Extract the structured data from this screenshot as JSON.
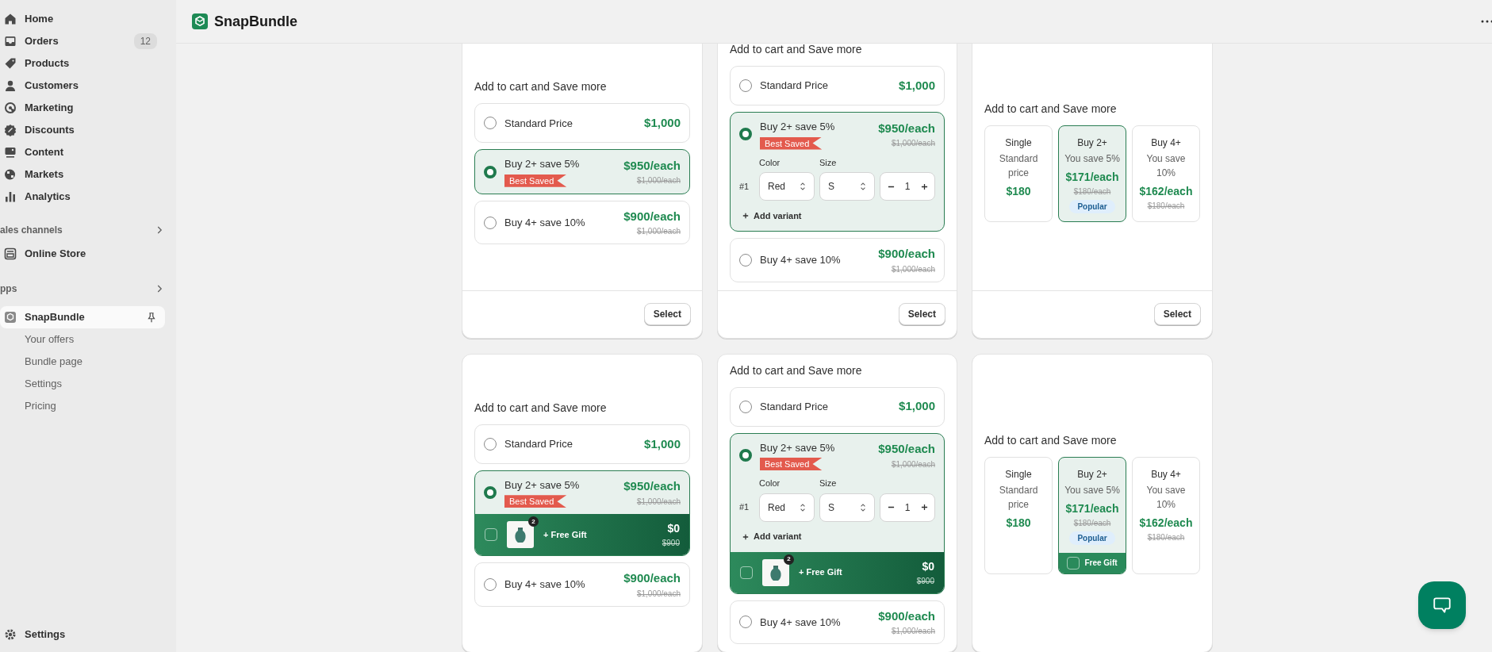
{
  "sidebar": {
    "nav": [
      {
        "label": "Home",
        "selected": false
      },
      {
        "label": "Orders",
        "badge": "12",
        "selected": false
      },
      {
        "label": "Products",
        "selected": false
      },
      {
        "label": "Customers",
        "selected": false
      },
      {
        "label": "Marketing",
        "selected": false
      },
      {
        "label": "Discounts",
        "selected": false
      },
      {
        "label": "Content",
        "selected": false
      },
      {
        "label": "Markets",
        "selected": false
      },
      {
        "label": "Analytics",
        "selected": false
      }
    ],
    "sales_channels": {
      "title": "ales channels",
      "items": [
        {
          "label": "Online Store",
          "selected": false
        }
      ]
    },
    "apps": {
      "title": "pps",
      "items": [
        {
          "label": "SnapBundle",
          "selected": true,
          "children": [
            {
              "label": "Your offers",
              "selected": false
            },
            {
              "label": "Bundle page",
              "selected": false
            },
            {
              "label": "Settings",
              "selected": false
            },
            {
              "label": "Pricing",
              "selected": false
            }
          ]
        }
      ]
    },
    "footer_item": {
      "label": "Settings"
    }
  },
  "header": {
    "title": "SnapBundle"
  },
  "cards": [
    {
      "kind": "list",
      "heading": "Add to cart and Save more",
      "button": "Select",
      "options": [
        {
          "label": "Standard Price",
          "price": "$1,000",
          "selected": false
        },
        {
          "label": "Buy 2+ save 5%",
          "badge": "Best Saved",
          "price": "$950/each",
          "original_price": "$1,000/each",
          "selected": true
        },
        {
          "label": "Buy 4+ save 10%",
          "price": "$900/each",
          "original_price": "$1,000/each",
          "selected": false
        }
      ]
    },
    {
      "kind": "list",
      "heading": "Add to cart and Save more",
      "button": "Select",
      "options": [
        {
          "label": "Standard Price",
          "price": "$1,000",
          "selected": false
        },
        {
          "label": "Buy 2+ save 5%",
          "badge": "Best Saved",
          "price": "$950/each",
          "original_price": "$1,000/each",
          "selected": true,
          "variants": {
            "row_label": "#1",
            "color_label": "Color",
            "color_value": "Red",
            "size_label": "Size",
            "size_value": "S",
            "quantity": "1",
            "add_label": "Add variant"
          }
        },
        {
          "label": "Buy 4+ save 10%",
          "price": "$900/each",
          "original_price": "$1,000/each",
          "selected": false
        }
      ]
    },
    {
      "kind": "tiles",
      "heading": "Add to cart and Save more",
      "button": "Select",
      "tiles": [
        {
          "title": "Single",
          "subtitle": "Standard price",
          "price": "$180",
          "selected": false
        },
        {
          "title": "Buy 2+",
          "subtitle": "You save 5%",
          "price": "$171/each",
          "original_price": "$180/each",
          "badge": "Popular",
          "selected": true
        },
        {
          "title": "Buy 4+",
          "subtitle": "You save 10%",
          "price": "$162/each",
          "original_price": "$180/each",
          "selected": false
        }
      ]
    },
    {
      "kind": "list",
      "heading": "Add to cart and Save more",
      "options": [
        {
          "label": "Standard Price",
          "price": "$1,000",
          "selected": false
        },
        {
          "label": "Buy 2+ save 5%",
          "badge": "Best Saved",
          "price": "$950/each",
          "original_price": "$1,000/each",
          "selected": true,
          "gift": {
            "label": "+ Free Gift",
            "quantity": "2",
            "price": "$0",
            "original_price": "$900",
            "checked": false
          }
        },
        {
          "label": "Buy 4+ save 10%",
          "price": "$900/each",
          "original_price": "$1,000/each",
          "selected": false
        }
      ]
    },
    {
      "kind": "list",
      "heading": "Add to cart and Save more",
      "options": [
        {
          "label": "Standard Price",
          "price": "$1,000",
          "selected": false
        },
        {
          "label": "Buy 2+ save 5%",
          "badge": "Best Saved",
          "price": "$950/each",
          "original_price": "$1,000/each",
          "selected": true,
          "variants": {
            "row_label": "#1",
            "color_label": "Color",
            "color_value": "Red",
            "size_label": "Size",
            "size_value": "S",
            "quantity": "1",
            "add_label": "Add variant"
          },
          "gift": {
            "label": "+ Free Gift",
            "quantity": "2",
            "price": "$0",
            "original_price": "$900",
            "checked": false
          }
        },
        {
          "label": "Buy 4+ save 10%",
          "price": "$900/each",
          "original_price": "$1,000/each",
          "selected": false
        }
      ]
    },
    {
      "kind": "tiles",
      "heading": "Add to cart and Save more",
      "tiles": [
        {
          "title": "Single",
          "subtitle": "Standard price",
          "price": "$180",
          "selected": false
        },
        {
          "title": "Buy 2+",
          "subtitle": "You save 5%",
          "price": "$171/each",
          "original_price": "$180/each",
          "badge": "Popular",
          "selected": true,
          "gift": {
            "label": "Free Gift",
            "checked": false
          }
        },
        {
          "title": "Buy 4+",
          "subtitle": "You save 10%",
          "price": "$162/each",
          "original_price": "$180/each",
          "selected": false
        }
      ]
    }
  ]
}
